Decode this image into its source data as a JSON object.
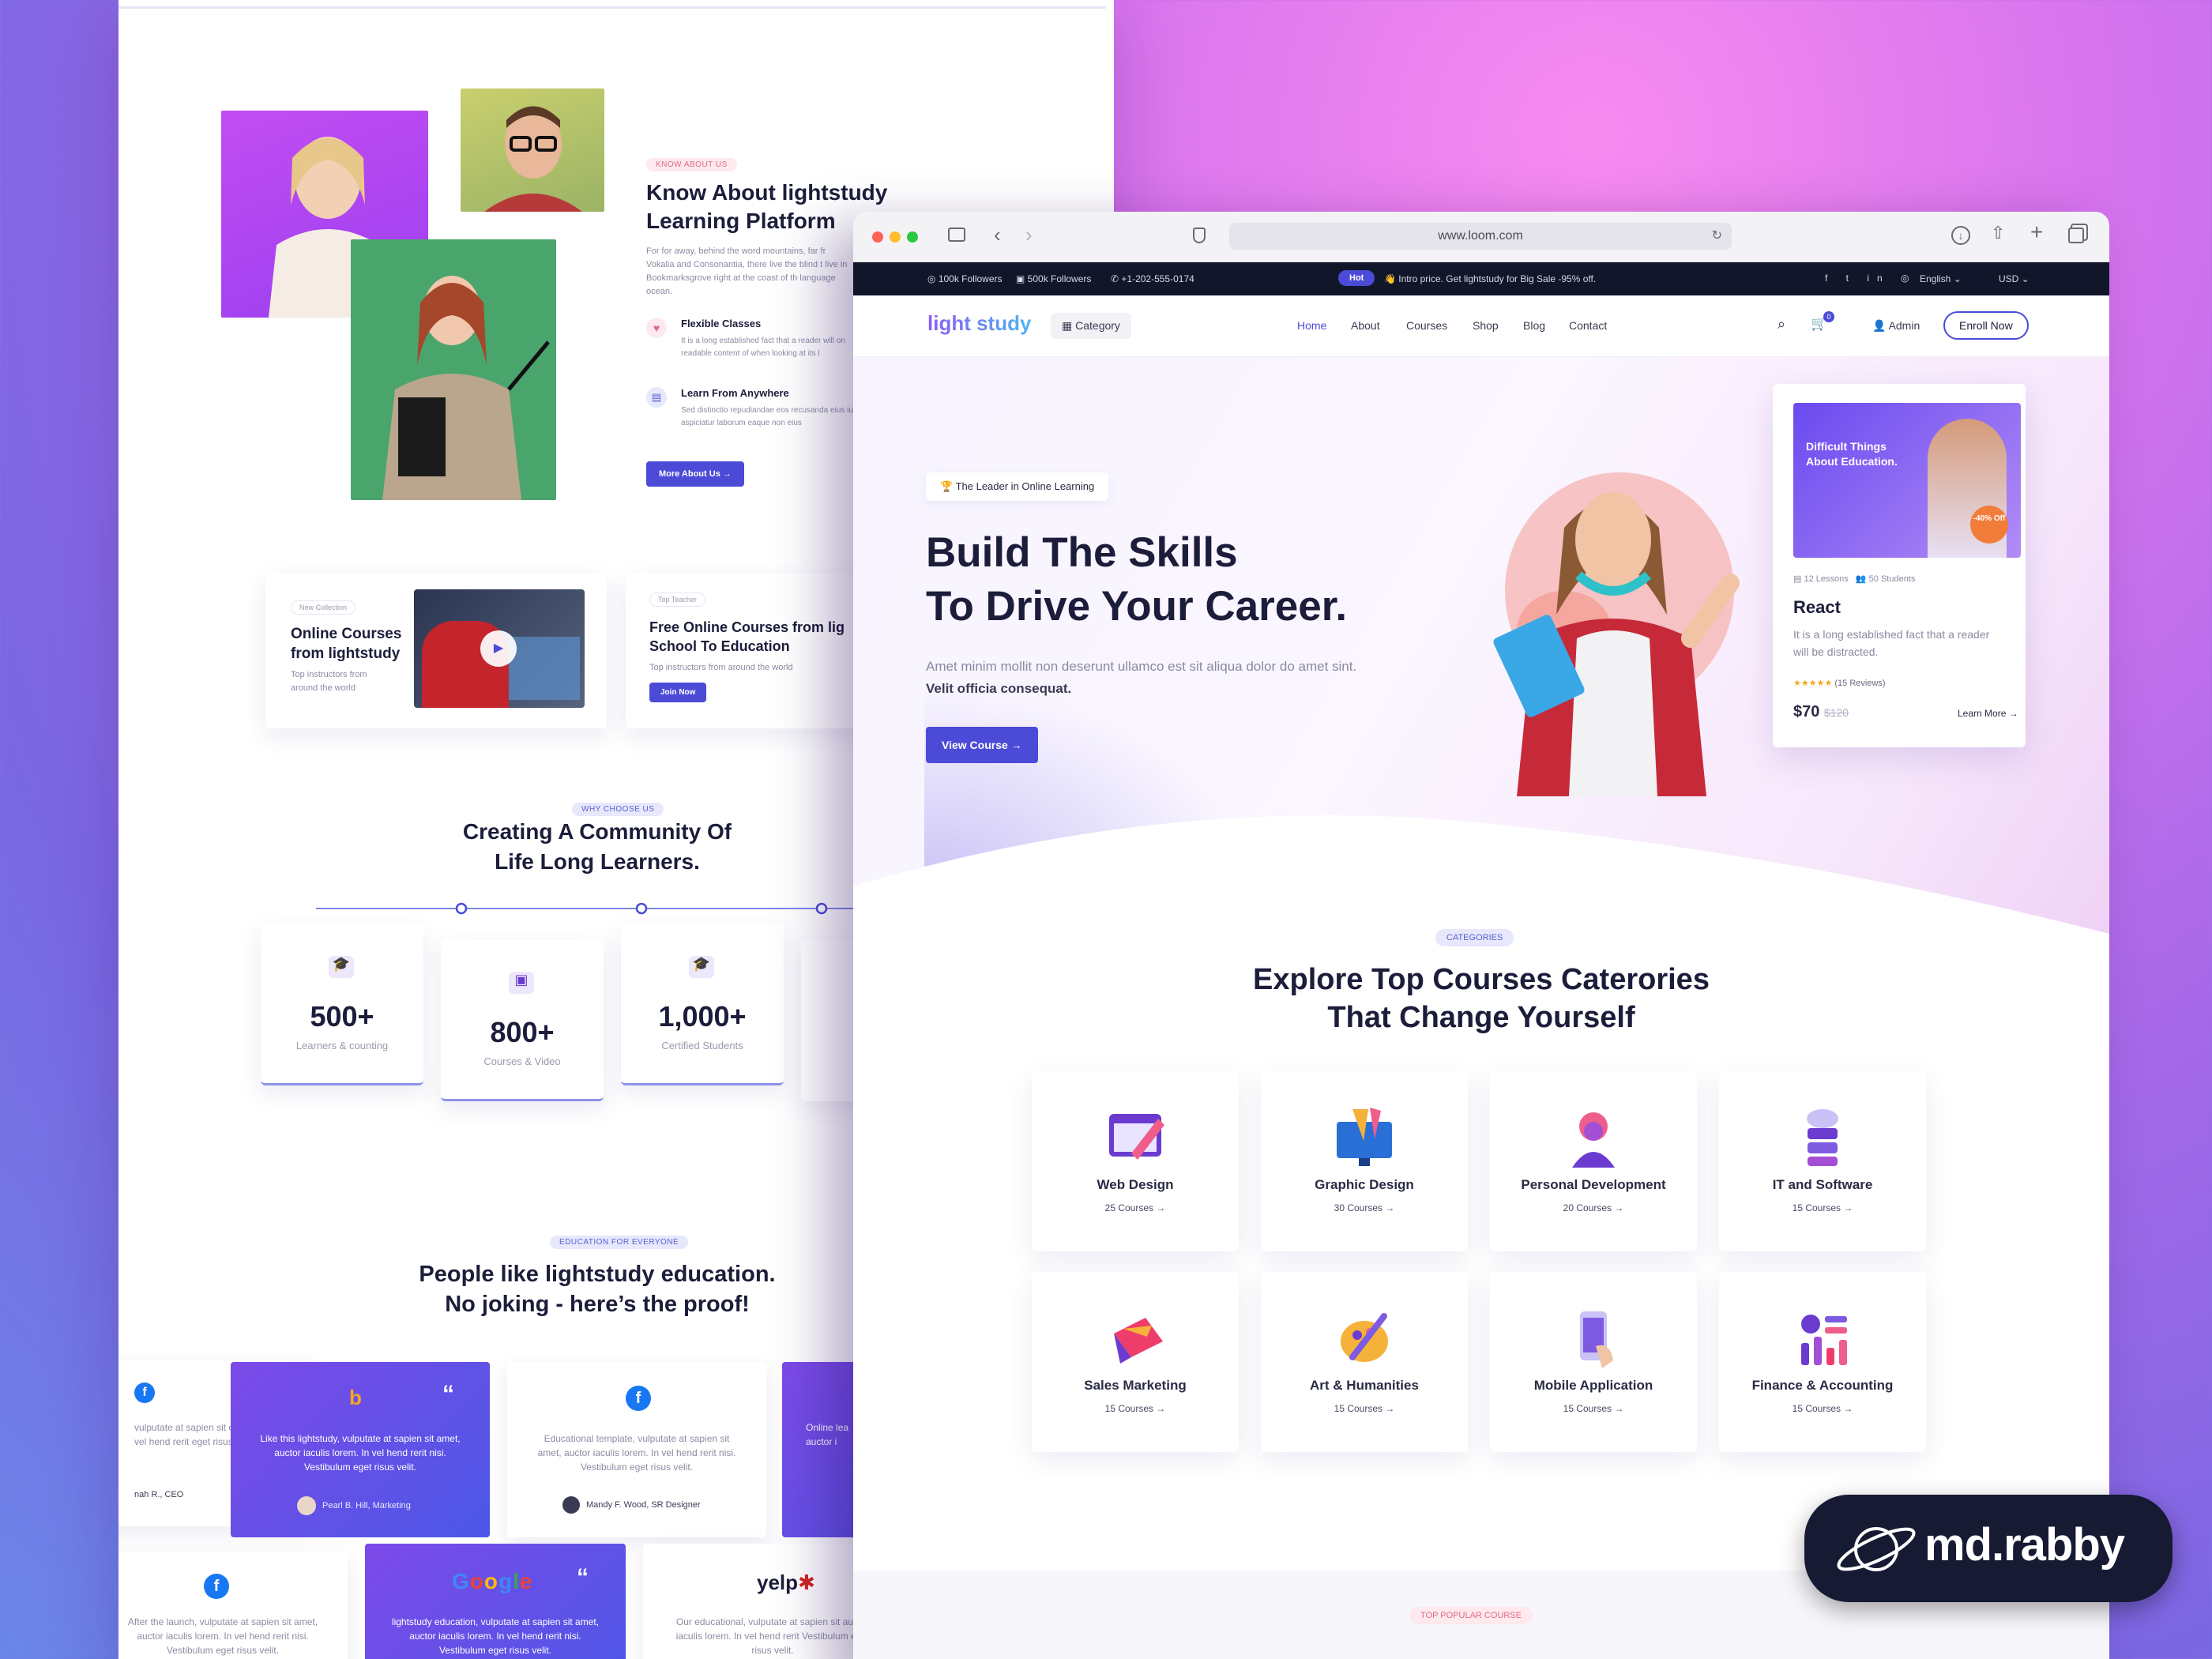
{
  "back_page": {
    "about": {
      "tag": "KNOW ABOUT US",
      "title_line1": "Know About lightstudy",
      "title_line2": "Learning Platform",
      "text": "For for away, behind the word mountains, far fr Vokalia and Consonantia, there live the blind t live in Bookmarksgrove right at the coast of th language ocean.",
      "features": [
        {
          "title": "Flexible Classes",
          "text": "It is a long established fact that a reader will on readable content of when looking at its l"
        },
        {
          "title": "Learn From Anywhere",
          "text": "Sed distinctio repudiandae eos recusanda eius iure aspiciatur laborum eaque non eius"
        }
      ],
      "button": "More About Us →"
    },
    "promo_cards": [
      {
        "tag": "New Collection",
        "title_line1": "Online Courses",
        "title_line2": "from lightstudy",
        "text_line1": "Top instructors from",
        "text_line2": "around the world"
      },
      {
        "tag": "Top Teacher",
        "title_line1": "Free Online Courses from lig",
        "title_line2": "School To Education",
        "text": "Top instructors from around the world",
        "button": "Join Now"
      }
    ],
    "community": {
      "tag": "WHY CHOOSE US",
      "title_line1": "Creating A Community Of",
      "title_line2": "Life Long Learners.",
      "stats": [
        {
          "number": "500+",
          "label": "Learners & counting"
        },
        {
          "number": "800+",
          "label": "Courses & Video"
        },
        {
          "number": "1,000+",
          "label": "Certified Students"
        }
      ]
    },
    "proof": {
      "tag": "EDUCATION FOR EVERYONE",
      "title_line1": "People like lightstudy education.",
      "title_line2": "No joking - here’s the proof!",
      "testimonials": [
        {
          "text": "vulputate at sapien sit orem. In vel hend rerit eget risus velit.",
          "author": "nah R., CEO"
        },
        {
          "text": "Like this lightstudy, vulputate at sapien sit amet, auctor iaculis lorem. In vel hend rerit nisi. Vestibulum eget risus velit.",
          "author": "Pearl B. Hill, Marketing"
        },
        {
          "text": "Educational template, vulputate at sapien sit amet, auctor iaculis lorem. In vel hend rerit nisi. Vestibulum eget risus velit.",
          "author": "Mandy F. Wood, SR Designer"
        },
        {
          "text": "Online lea auctor i",
          "author": ""
        },
        {
          "text": "After the launch, vulputate at sapien sit amet, auctor iaculis lorem. In vel hend rerit nisi. Vestibulum eget risus velit.",
          "author": ""
        },
        {
          "text": "lightstudy education, vulputate at sapien sit amet, auctor iaculis lorem. In vel hend rerit nisi. Vestibulum eget risus velit.",
          "author": ""
        },
        {
          "text": "Our educational, vulputate at sapien sit auctor iaculis lorem. In vel hend rerit Vestibulum eget risus velit.",
          "author": ""
        }
      ],
      "logo_google": "Google",
      "logo_yelp": "yelp"
    }
  },
  "browser": {
    "url": "www.loom.com",
    "topbar": {
      "instagram": "100k Followers",
      "facebook": "500k Followers",
      "phone": "+1-202-555-0174",
      "hot": "Hot",
      "promo": "Intro price. Get lightstudy for Big Sale -95% off.",
      "language": "English",
      "currency": "USD"
    },
    "nav": {
      "logo": "light study",
      "category": "Category",
      "links": [
        "Home",
        "About",
        "Courses",
        "Shop",
        "Blog",
        "Contact"
      ],
      "cart_count": "0",
      "admin": "Admin",
      "enroll": "Enroll Now"
    },
    "hero": {
      "badge": "The Leader in Online Learning",
      "title_line1": "Build The Skills",
      "title_line2": "To Drive Your Career.",
      "text": "Amet minim mollit non deserunt ullamco est sit aliqua dolor do amet sint.",
      "text_bold": "Velit officia consequat.",
      "button": "View Course →"
    },
    "course_card": {
      "thumb_title_line1": "Difficult Things",
      "thumb_title_line2": "About Education.",
      "thumb_discount": "-40% Off",
      "lessons": "12 Lessons",
      "students": "50 Students",
      "title": "React",
      "text": "It is a long established fact that a reader will be distracted.",
      "rating": 5,
      "reviews": "(15 Reviews)",
      "price": "$70",
      "old_price": "$120",
      "learn_more": "Learn More →"
    },
    "categories": {
      "tag": "CATEGORIES",
      "title_line1": "Explore Top Courses Caterories",
      "title_line2": "That Change Yourself",
      "items": [
        {
          "title": "Web Design",
          "count": "25 Courses →"
        },
        {
          "title": "Graphic Design",
          "count": "30 Courses →"
        },
        {
          "title": "Personal Development",
          "count": "20 Courses →"
        },
        {
          "title": "IT and Software",
          "count": "15 Courses →"
        },
        {
          "title": "Sales Marketing",
          "count": "15 Courses →"
        },
        {
          "title": "Art & Humanities",
          "count": "15 Courses →"
        },
        {
          "title": "Mobile Application",
          "count": "15 Courses →"
        },
        {
          "title": "Finance & Accounting",
          "count": "15 Courses →"
        }
      ]
    },
    "popular_tag": "TOP POPULAR COURSE"
  },
  "brand": {
    "name": "md.rabby"
  },
  "colors": {
    "primary": "#4b4bd8",
    "dark": "#11162b",
    "accent_pink": "#e16a86",
    "logo_gradient": [
      "#8a5cf6",
      "#4fb6f0"
    ]
  }
}
